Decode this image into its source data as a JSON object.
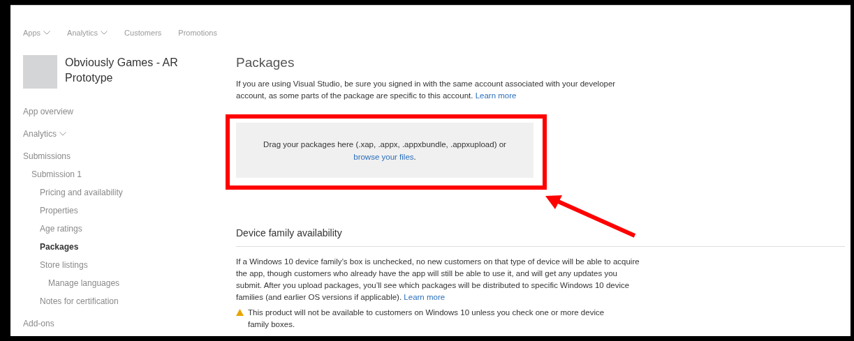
{
  "top_nav": [
    {
      "label": "Apps",
      "dropdown": true
    },
    {
      "label": "Analytics",
      "dropdown": true
    },
    {
      "label": "Customers",
      "dropdown": false
    },
    {
      "label": "Promotions",
      "dropdown": false
    }
  ],
  "app": {
    "name": "Obviously Games - AR Prototype"
  },
  "sidebar": {
    "items": [
      {
        "label": "App overview",
        "dropdown": false,
        "selected": false
      },
      {
        "label": "Analytics",
        "dropdown": true,
        "selected": false
      },
      {
        "label": "Submissions",
        "dropdown": false,
        "selected": false,
        "children": [
          {
            "label": "Submission 1",
            "dropdown": false,
            "selected": false,
            "children": [
              {
                "label": "Pricing and availability",
                "dropdown": false,
                "selected": false
              },
              {
                "label": "Properties",
                "dropdown": false,
                "selected": false
              },
              {
                "label": "Age ratings",
                "dropdown": false,
                "selected": false
              },
              {
                "label": "Packages",
                "dropdown": false,
                "selected": true
              },
              {
                "label": "Store listings",
                "dropdown": false,
                "selected": false,
                "children": [
                  {
                    "label": "Manage languages",
                    "dropdown": false,
                    "selected": false
                  }
                ]
              },
              {
                "label": "Notes for certification",
                "dropdown": false,
                "selected": false
              }
            ]
          }
        ]
      },
      {
        "label": "Add-ons",
        "dropdown": false,
        "selected": false
      }
    ]
  },
  "packages": {
    "title": "Packages",
    "text": "If you are using Visual Studio, be sure you signed in with the same account associated with your developer account, as some parts of the package are specific to this account.",
    "link": "Learn more",
    "drop_zone": {
      "text": "Drag your packages here (.xap, .appx, .appxbundle, .appxupload)  or",
      "link": "browse your files",
      "after": "."
    }
  },
  "device_family": {
    "title": "Device family availability",
    "text": "If a Windows 10 device family’s box is unchecked, no new customers on that type of device will be able to acquire the app, though customers who already have the app will still be able to use it, and will get any updates you submit. After you upload packages, you’ll see which packages will be distributed to specific Windows 10 device families (and earlier OS versions if applicable).",
    "link": "Learn more",
    "warning": "This product will not be available to customers on Windows 10 unless you check one or more device family boxes."
  }
}
